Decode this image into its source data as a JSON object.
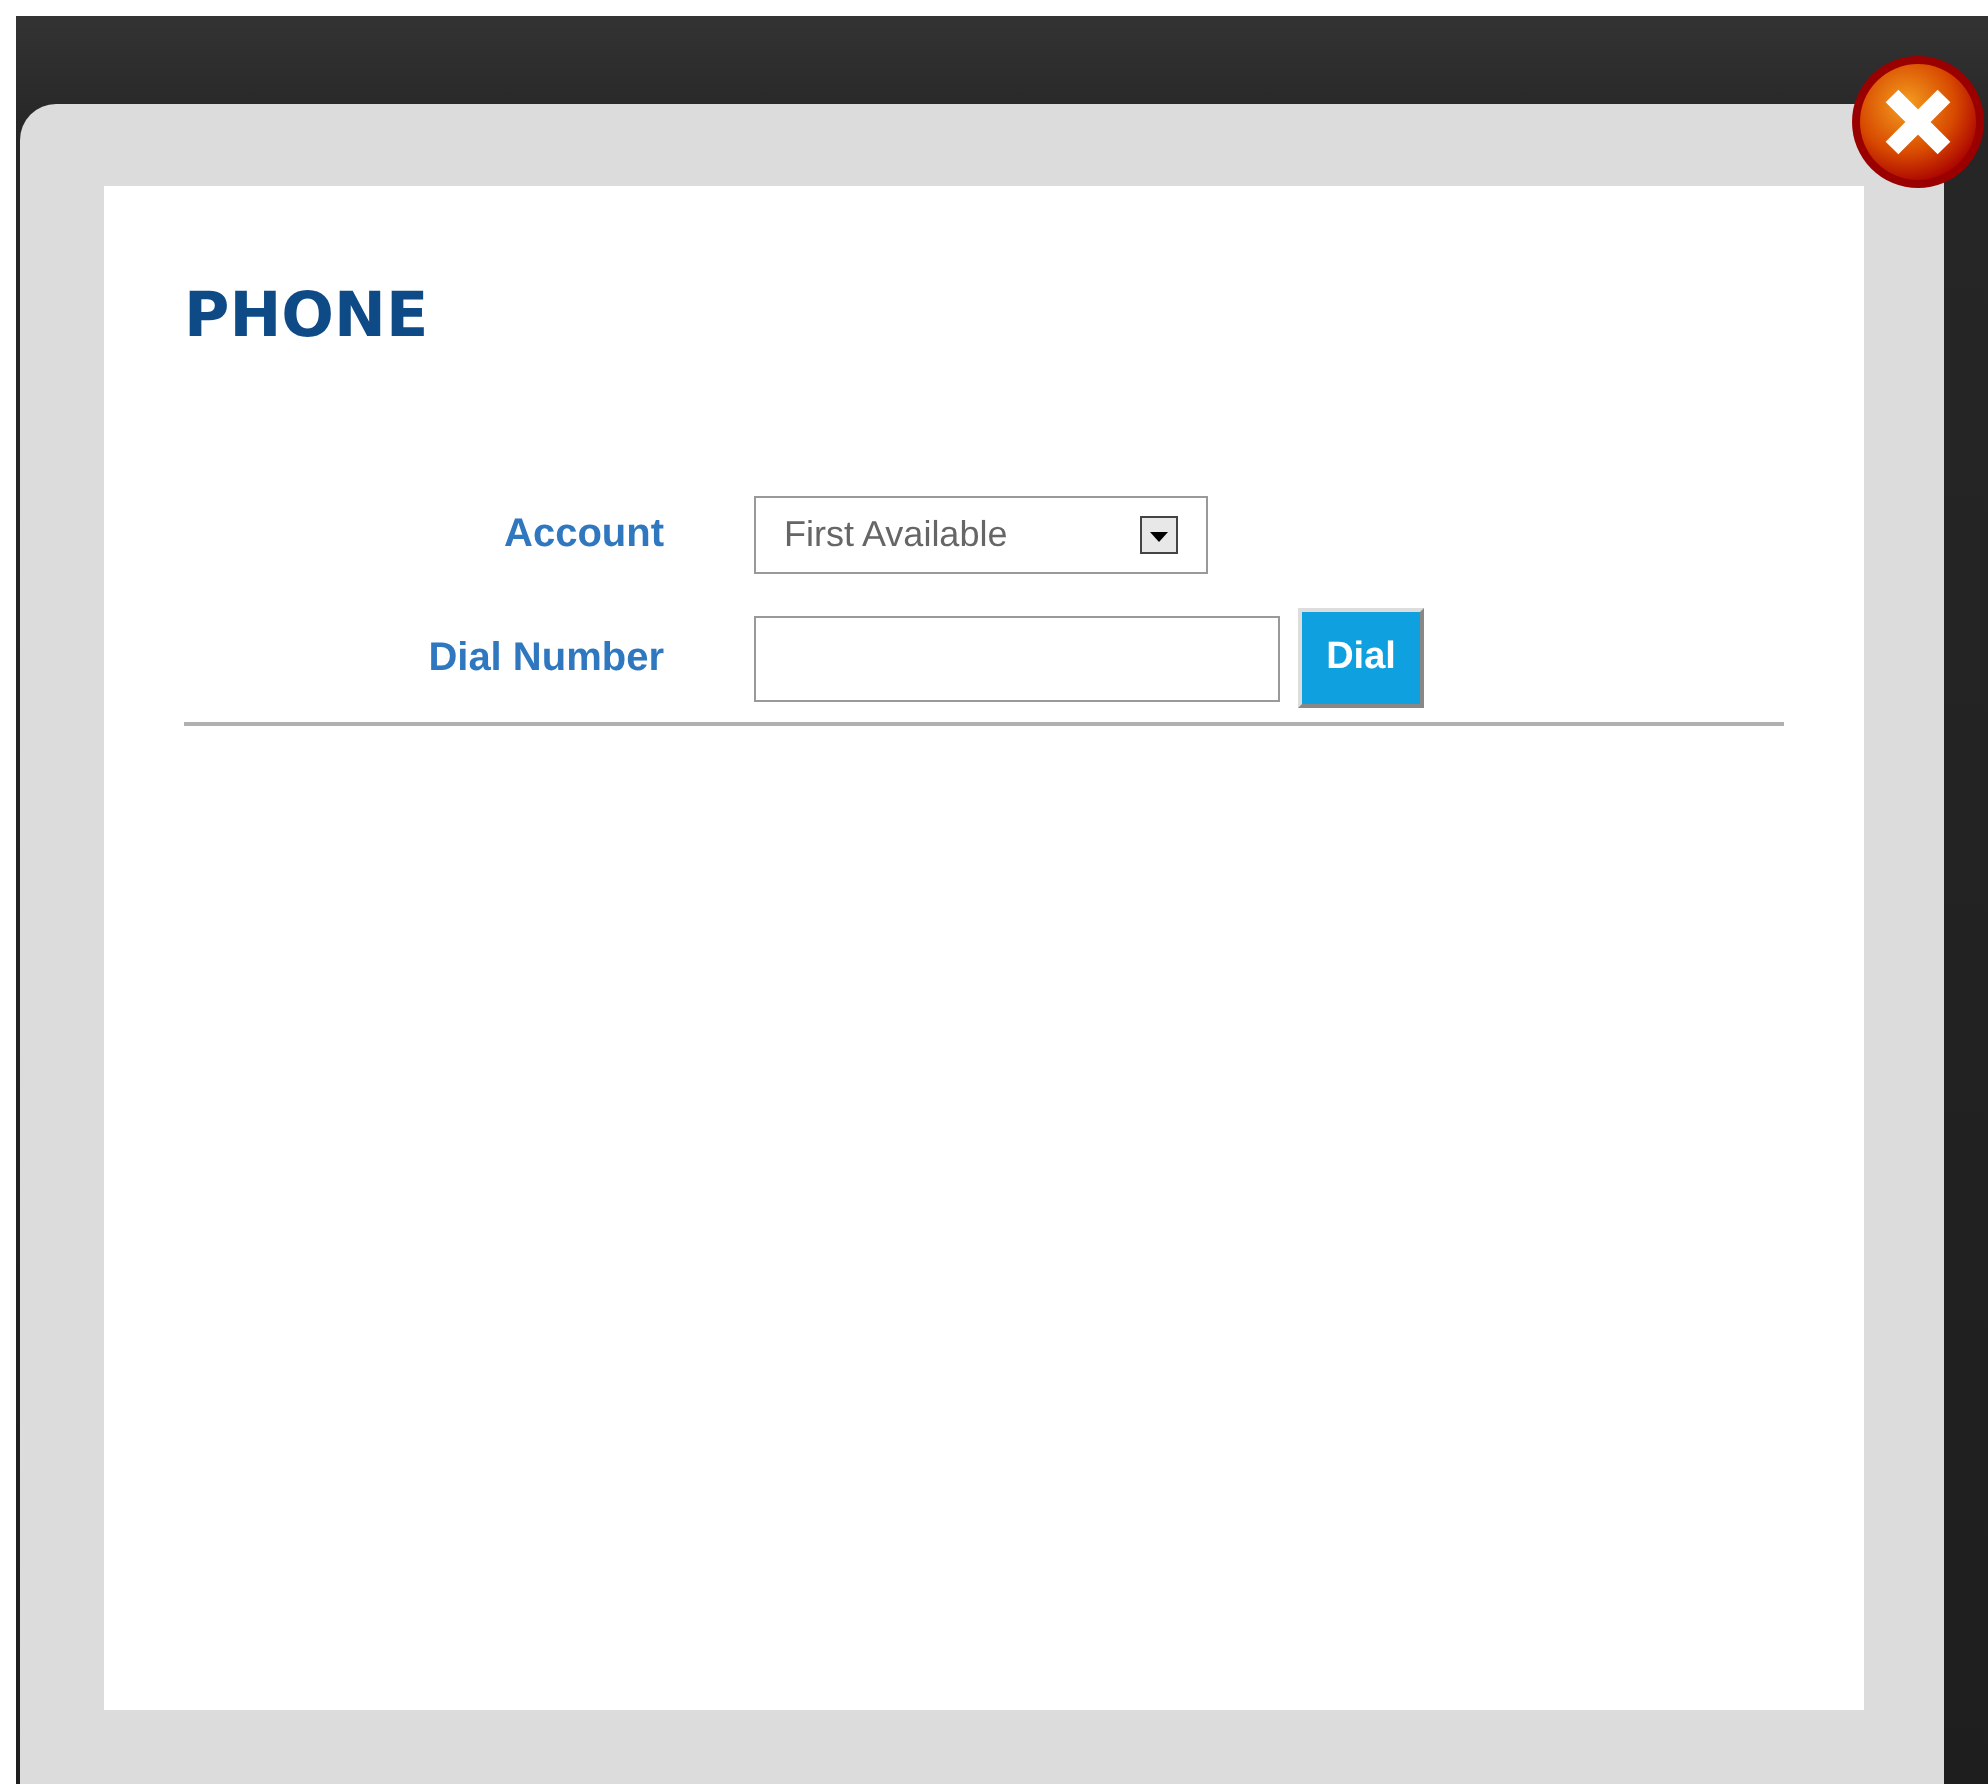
{
  "dialog": {
    "title": "PHONE",
    "fields": [
      {
        "kind": "select",
        "label": "Account",
        "value": "First Available"
      },
      {
        "kind": "input",
        "label": "Dial Number",
        "button": "Dial"
      }
    ]
  }
}
